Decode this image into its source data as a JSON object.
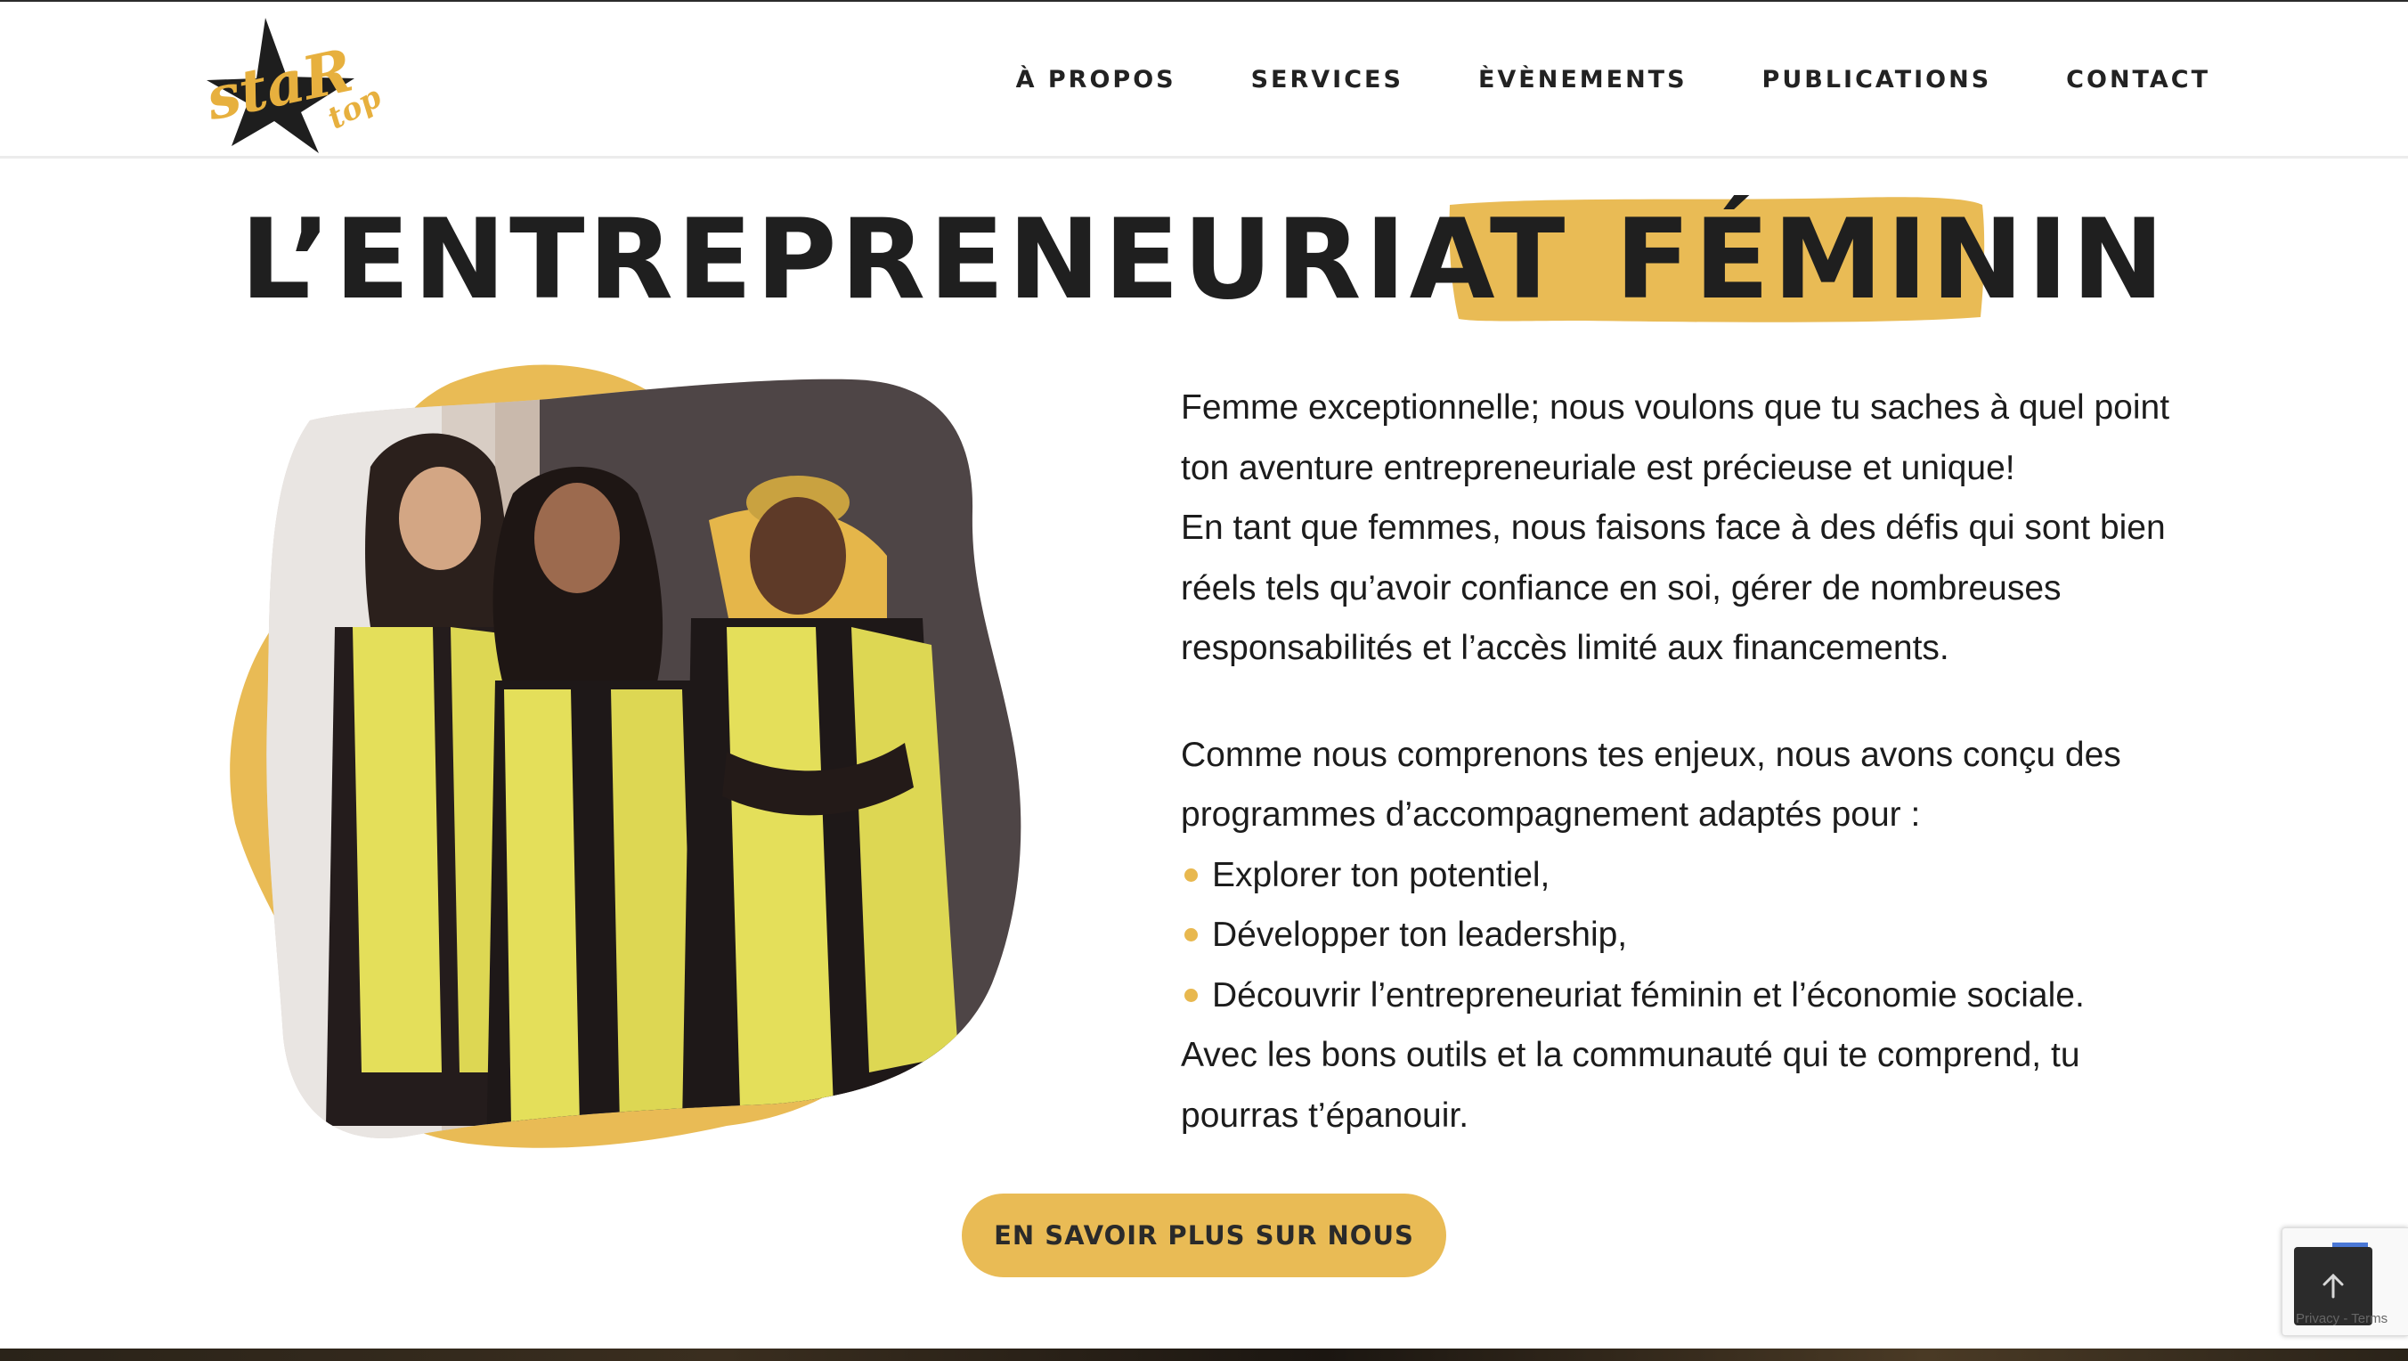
{
  "header": {
    "logo_text": "StaR top",
    "nav": [
      "À PROPOS",
      "SERVICES",
      "ÈVÈNEMENTS",
      "PUBLICATIONS",
      "CONTACT"
    ]
  },
  "hero": {
    "headline_part1": "L’ENTREPRENEURIAT",
    "headline_part2": "FÉMININ"
  },
  "content": {
    "paragraph1": [
      "Femme exceptionnelle; nous voulons que tu saches à quel point",
      "ton aventure entrepreneuriale est précieuse et unique!",
      "En tant que femmes, nous faisons face à des défis qui sont bien",
      "réels tels qu’avoir confiance en soi, gérer de nombreuses",
      "responsabilités et l’accès limité aux financements."
    ],
    "paragraph2_intro": [
      "Comme nous comprenons tes enjeux, nous avons conçu des",
      "programmes d’accompagnement adaptés pour :"
    ],
    "bullets": [
      "Explorer ton potentiel,",
      "Développer ton leadership,",
      "Découvrir l’entrepreneuriat féminin et l’économie sociale."
    ],
    "closing": [
      "Avec les bons outils et la communauté qui te comprend, tu",
      "pourras t’épanouir."
    ]
  },
  "cta": {
    "label": "EN SAVOIR PLUS SUR NOUS"
  },
  "recaptcha": {
    "terms": "Privacy - Terms"
  },
  "colors": {
    "accent": "#e9bb55",
    "text": "#1c1c1c",
    "vest_yellow": "#e4df5a"
  },
  "icons": {
    "scroll_top": "arrow-up-icon",
    "bullet": "dot-icon"
  }
}
